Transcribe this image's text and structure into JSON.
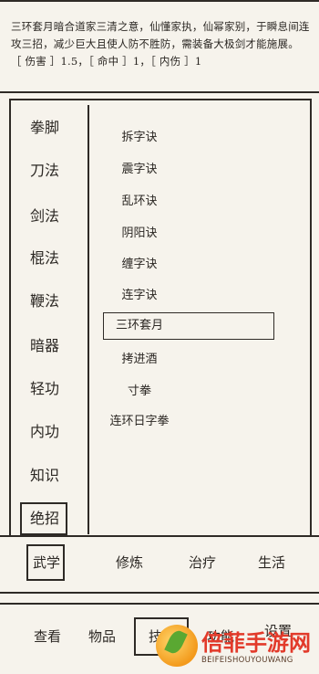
{
  "description": {
    "line1": "三环套月暗合道家三清之意，仙懂家执，仙幂家别，于瞬息间连",
    "line2": "攻三招，减少巨大且使人防不胜防，需装备大极剑才能施展。",
    "line3": "［ 伤害 ］1.5，［ 命中 ］1，［ 内伤 ］1"
  },
  "categories": [
    "拳脚",
    "刀法",
    "剑法",
    "棍法",
    "鞭法",
    "暗器",
    "轻功",
    "内功",
    "知识",
    "绝招"
  ],
  "selected_category": "绝招",
  "skills": [
    "拆字诀",
    "震字诀",
    "乱环诀",
    "阴阳诀",
    "缠字诀",
    "连字诀",
    "三环套月",
    "拷进酒",
    "寸拳",
    "连环日字拳"
  ],
  "selected_skill": "三环套月",
  "tabs": [
    "武学",
    "修炼",
    "治疗",
    "生活"
  ],
  "selected_tab": "武学",
  "nav": [
    "查看",
    "物品",
    "技能",
    "功能",
    "设置"
  ],
  "selected_nav": "技能",
  "watermark": {
    "name": "倍菲手游网",
    "url": "BEIFEISHOUYOUWANG"
  }
}
